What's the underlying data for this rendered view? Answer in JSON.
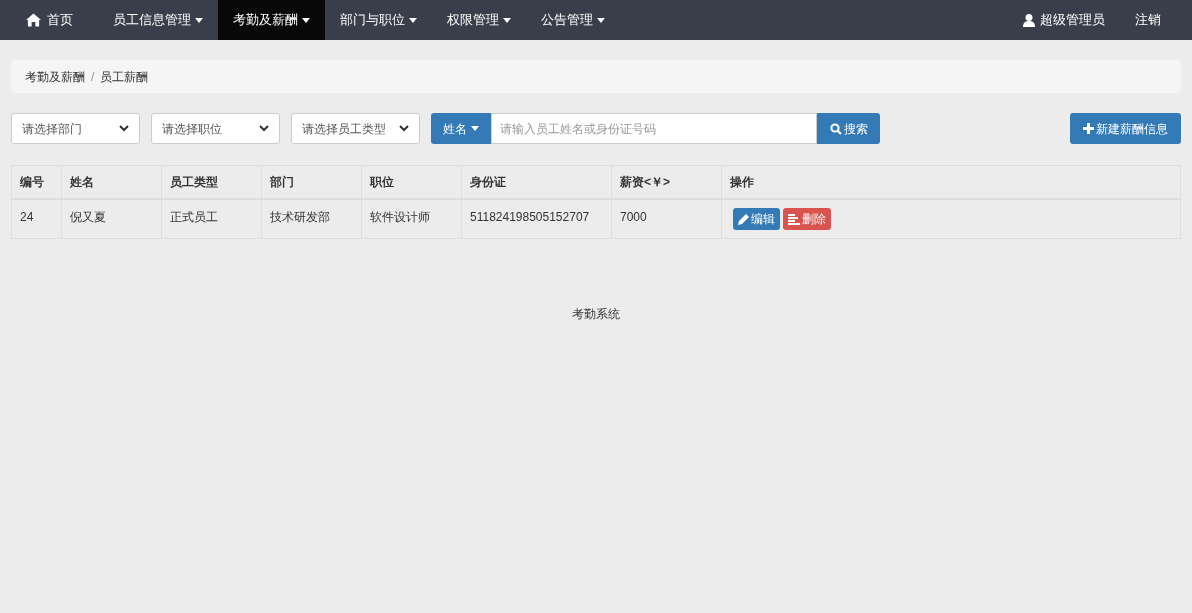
{
  "navbar": {
    "items": [
      {
        "label": "首页",
        "kind": "home",
        "selected": false
      },
      {
        "label": "员工信息管理",
        "kind": "dropdown",
        "selected": false
      },
      {
        "label": "考勤及薪酬",
        "kind": "dropdown",
        "selected": true
      },
      {
        "label": "部门与职位",
        "kind": "dropdown",
        "selected": false
      },
      {
        "label": "权限管理",
        "kind": "dropdown",
        "selected": false
      },
      {
        "label": "公告管理",
        "kind": "dropdown",
        "selected": false
      }
    ],
    "user": "超级管理员",
    "logout": "注销"
  },
  "breadcrumb": {
    "items": [
      "考勤及薪酬",
      "员工薪酬"
    ],
    "separator": "/"
  },
  "filters": {
    "selects": [
      "请选择部门",
      "请选择职位",
      "请选择员工类型"
    ],
    "search_by": "姓名",
    "search": {
      "placeholder": "请输入员工姓名或身份证号码"
    },
    "search_button": "搜索",
    "new_button": "新建薪酬信息"
  },
  "table": {
    "columns": [
      "编号",
      "姓名",
      "员工类型",
      "部门",
      "职位",
      "身份证",
      "薪资<￥>",
      "操作"
    ],
    "rows": [
      {
        "cells": [
          "24",
          "倪又夏",
          "正式员工",
          "技术研发部",
          "软件设计师",
          "511824198505152707",
          "7000"
        ],
        "actions": [
          "编辑",
          "删除"
        ]
      }
    ]
  },
  "footer": "考勤系统"
}
